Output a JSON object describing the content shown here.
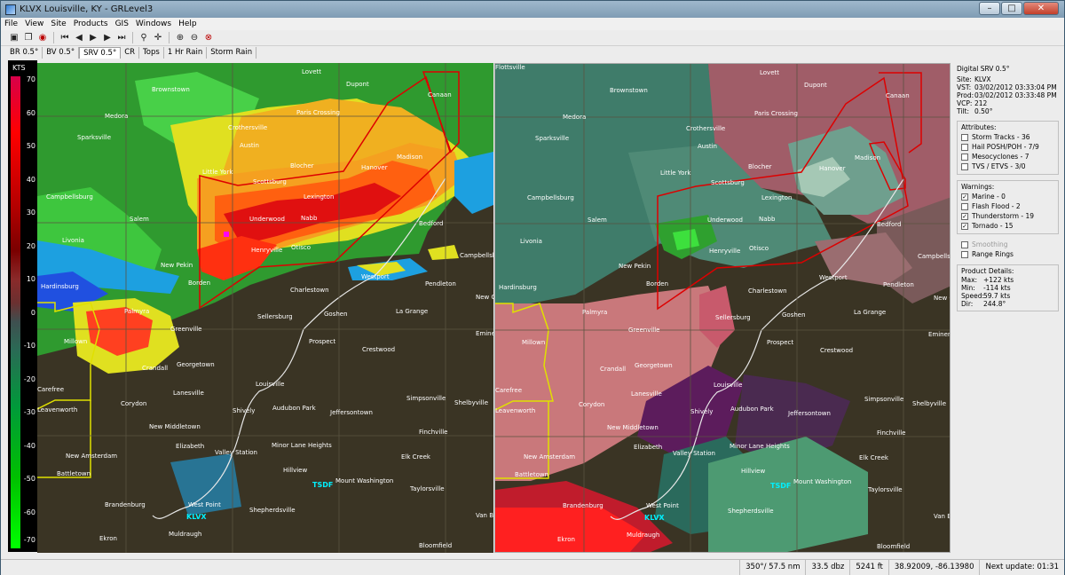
{
  "window": {
    "title": "KLVX Louisville, KY - GRLevel3",
    "minimize": "–",
    "maximize": "□",
    "close": "✕"
  },
  "menu": [
    "File",
    "View",
    "Site",
    "Products",
    "GIS",
    "Windows",
    "Help"
  ],
  "toolbar_icons": [
    "open-icon",
    "copy-icon",
    "radar-icon",
    "first-frame-icon",
    "step-back-icon",
    "play-icon",
    "step-forward-icon",
    "last-frame-icon",
    "zoom-icon",
    "pan-icon",
    "zoom-in-icon",
    "zoom-out-icon",
    "zoom-reset-icon"
  ],
  "product_tabs": [
    "BR 0.5°",
    "BV 0.5°",
    "SRV 0.5°",
    "CR",
    "Tops",
    "1 Hr Rain",
    "Storm Rain"
  ],
  "active_tab": "SRV 0.5°",
  "legend": {
    "unit": "KTS",
    "labels": [
      "70",
      "60",
      "50",
      "40",
      "30",
      "20",
      "10",
      "0",
      "-10",
      "-20",
      "-30",
      "-40",
      "-50",
      "-60",
      "-70"
    ]
  },
  "map_labels": [
    "Lovett",
    "Dupont",
    "Canaan",
    "Brownstown",
    "Medora",
    "Paris Crossing",
    "Crothersville",
    "Sparksville",
    "Austin",
    "Madison",
    "Hanover",
    "Blocher",
    "Little York",
    "Scottsburg",
    "Campbellsburg",
    "Lexington",
    "Salem",
    "Underwood",
    "Nabb",
    "Bedford",
    "Livonia",
    "Henryville",
    "Otisco",
    "Campbellsburg",
    "New Pekin",
    "Borden",
    "Westport",
    "Hardinsburg",
    "Pendleton",
    "Charlestown",
    "Palmyra",
    "Sellersburg",
    "Goshen",
    "La Grange",
    "Greenville",
    "Prospect",
    "Millown",
    "Crestwood",
    "Crandall",
    "Georgetown",
    "Carefree",
    "Lanesville",
    "Louisville",
    "Simpsonville",
    "Corydon",
    "Shelbyville",
    "Leavenworth",
    "Shively",
    "Audubon Park",
    "Jeffersontown",
    "New Middletown",
    "Finchville",
    "Elizabeth",
    "Minor Lane Heights",
    "New Amsterdam",
    "Valley Station",
    "Elk Creek",
    "Battletown",
    "Hillview",
    "TSDF",
    "Mount Washington",
    "Taylorsville",
    "Brandenburg",
    "West Point",
    "KLVX",
    "Shepherdsville",
    "Ekron",
    "Muldraugh",
    "Bloomfield",
    "Eminence",
    "Van B",
    "New C",
    "Flottsville",
    "Lexington"
  ],
  "info": {
    "product": "Digital SRV 0.5°",
    "rows": [
      {
        "k": "Site:",
        "v": "KLVX"
      },
      {
        "k": "VST:",
        "v": "03/02/2012 03:33:04 PM"
      },
      {
        "k": "Prod:",
        "v": "03/02/2012 03:33:48 PM"
      },
      {
        "k": "VCP:",
        "v": "212"
      },
      {
        "k": "Tilt:",
        "v": "0.50°"
      }
    ]
  },
  "attributes": {
    "title": "Attributes:",
    "items": [
      {
        "label": "Storm Tracks - 36",
        "checked": ""
      },
      {
        "label": "Hail POSH/POH - 7/9",
        "checked": ""
      },
      {
        "label": "Mesocyclones - 7",
        "checked": ""
      },
      {
        "label": "TVS / ETVS - 3/0",
        "checked": ""
      }
    ]
  },
  "warnings": {
    "title": "Warnings:",
    "items": [
      {
        "label": "Marine - 0",
        "checked": "✓"
      },
      {
        "label": "Flash Flood - 2",
        "checked": ""
      },
      {
        "label": "Thunderstorm - 19",
        "checked": "✓"
      },
      {
        "label": "Tornado - 15",
        "checked": "✓"
      }
    ]
  },
  "options": [
    {
      "label": "Smoothing",
      "checked": ""
    },
    {
      "label": "Range Rings",
      "checked": ""
    }
  ],
  "details": {
    "title": "Product Details:",
    "rows": [
      {
        "k": "Max:",
        "v": "+122 kts"
      },
      {
        "k": "Min:",
        "v": "-114 kts"
      },
      {
        "k": "Speed:",
        "v": "59.7 kts"
      },
      {
        "k": "Dir:",
        "v": "244.8°"
      }
    ]
  },
  "status": {
    "bearing": "350°/ 57.5 nm",
    "value": "33.5 dbz",
    "height": "5241 ft",
    "coords": "38.92009, -86.13980",
    "next": "Next update: 01:31"
  }
}
